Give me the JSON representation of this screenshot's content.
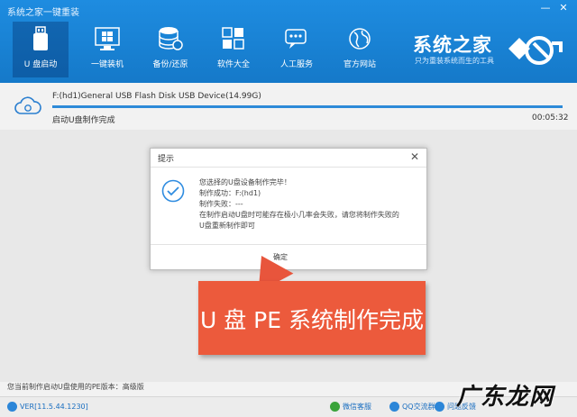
{
  "window": {
    "title": "系统之家一键重装",
    "min_label": "—",
    "close_label": "✕"
  },
  "nav": {
    "items": [
      {
        "label": "U 盘启动",
        "icon": "usb-drive-icon"
      },
      {
        "label": "一键装机",
        "icon": "windows-logo-icon"
      },
      {
        "label": "备份/还原",
        "icon": "database-backup-icon"
      },
      {
        "label": "软件大全",
        "icon": "app-grid-icon"
      },
      {
        "label": "人工服务",
        "icon": "chat-bubble-icon"
      },
      {
        "label": "官方网站",
        "icon": "globe-icon"
      }
    ],
    "active_index": 0
  },
  "brand": {
    "name": "系统之家",
    "tagline": "只为重装系统而生的工具"
  },
  "device": {
    "name": "F:(hd1)General USB Flash Disk USB Device(14.99G)",
    "progress": 1.0,
    "status": "启动U盘制作完成",
    "elapsed": "00:05:32"
  },
  "dialog": {
    "title": "提示",
    "close_label": "✕",
    "lines": [
      "您选择的U盘设备制作完毕！",
      "制作成功：F:(hd1)",
      "制作失败：---",
      "在制作启动U盘时可能存在极小几率会失败，请您将制作失败的",
      "U盘重新制作即可"
    ],
    "ok_label": "确定"
  },
  "callout": {
    "text": "U 盘 PE 系统制作完成"
  },
  "footer": {
    "notice": "您当前制作启动U盘使用的PE版本：高级版",
    "version": "VER[11.5.44.1230]",
    "links": [
      {
        "label": "微信客服",
        "icon": "wechat-icon"
      },
      {
        "label": "QQ交流群",
        "icon": "qq-icon"
      },
      {
        "label": "问题反馈",
        "icon": "feedback-icon"
      }
    ]
  },
  "watermark": "广东龙网",
  "colors": {
    "header_blue": "#1b86d8",
    "callout_red": "#ec5a3c",
    "progress_blue": "#2d8ad8",
    "ok_check_blue": "#2f8ce0"
  }
}
